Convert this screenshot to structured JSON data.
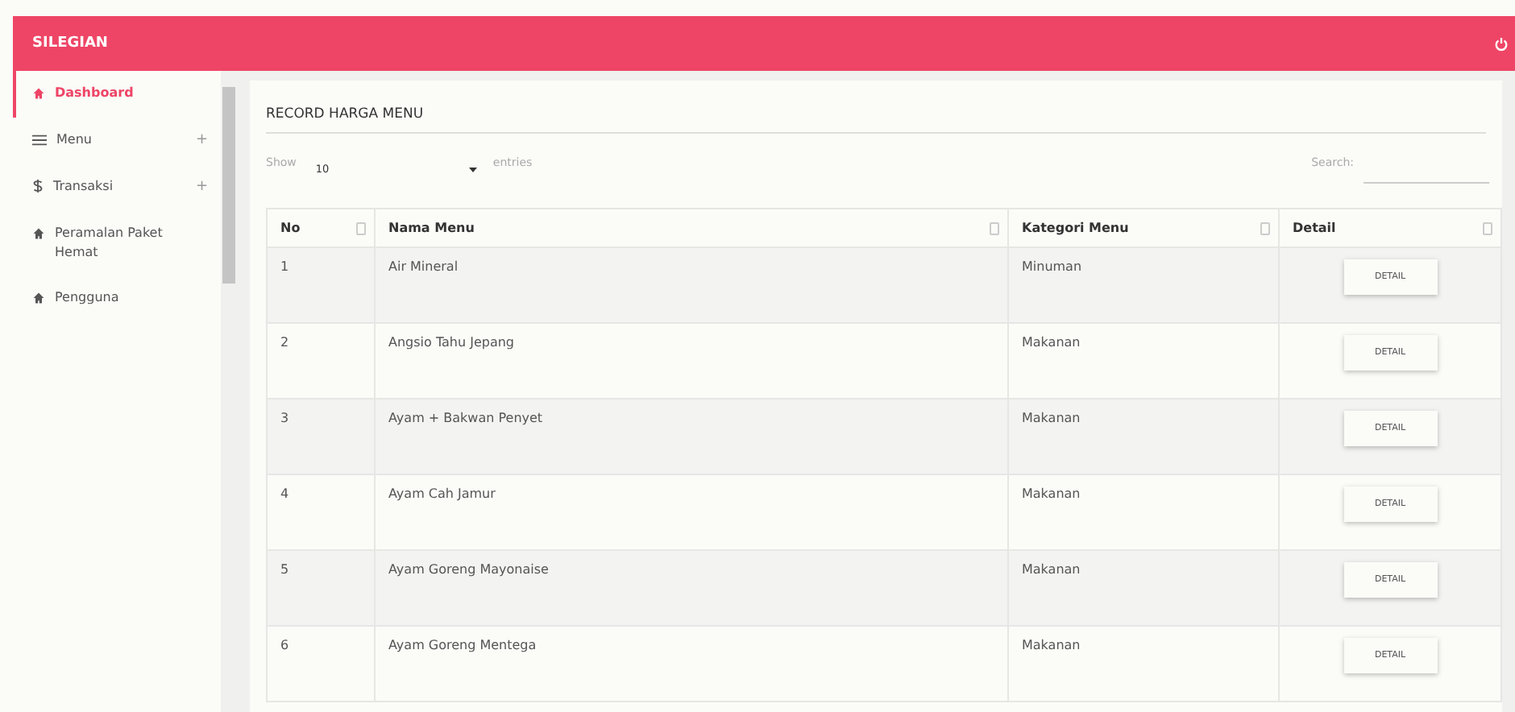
{
  "header": {
    "brand": "SILEGIAN"
  },
  "sidebar": {
    "items": [
      {
        "label": "Dashboard",
        "kind": "home",
        "selected": true
      },
      {
        "label": "Menu",
        "kind": "list",
        "selected": false,
        "toggle": "+"
      },
      {
        "label": "Transaksi",
        "kind": "money",
        "selected": false,
        "toggle": "+"
      },
      {
        "label": "Peramalan Paket Hemat",
        "kind": "home",
        "selected": false
      },
      {
        "label": "Pengguna",
        "kind": "home",
        "selected": false
      }
    ]
  },
  "panel": {
    "title": "RECORD HARGA MENU",
    "length": {
      "before": "Show",
      "value": "10",
      "after": "entries"
    },
    "search": {
      "label": "Search:"
    },
    "table": {
      "columns": [
        "No",
        "Nama Menu",
        "Kategori Menu",
        "Detail"
      ],
      "rows": [
        {
          "no": "1",
          "name": "Air Mineral",
          "category": "Minuman",
          "action": "DETAIL"
        },
        {
          "no": "2",
          "name": "Angsio Tahu Jepang",
          "category": "Makanan",
          "action": "DETAIL"
        },
        {
          "no": "3",
          "name": "Ayam + Bakwan Penyet",
          "category": "Makanan",
          "action": "DETAIL"
        },
        {
          "no": "4",
          "name": "Ayam Cah Jamur",
          "category": "Makanan",
          "action": "DETAIL"
        },
        {
          "no": "5",
          "name": "Ayam Goreng Mayonaise",
          "category": "Makanan",
          "action": "DETAIL"
        },
        {
          "no": "6",
          "name": "Ayam Goreng Mentega",
          "category": "Makanan",
          "action": "DETAIL"
        }
      ]
    }
  }
}
